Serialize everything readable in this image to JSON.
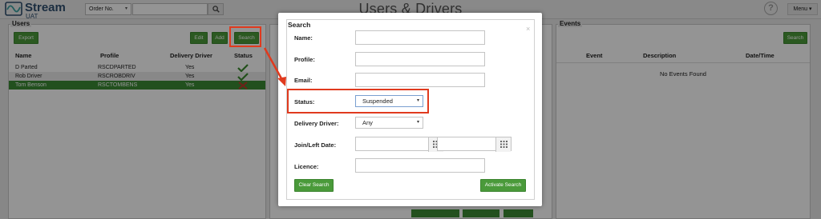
{
  "app": {
    "name": "Stream",
    "environment": "UAT",
    "title": "Users & Drivers",
    "help_symbol": "?",
    "menu_label": "Menu ▾"
  },
  "header": {
    "order_select_value": "Order No.",
    "order_select_caret": "▾"
  },
  "users": {
    "title": "Users",
    "export_label": "Export",
    "edit_label": "Edit",
    "add_label": "Add",
    "search_label": "Search",
    "columns": [
      "Name",
      "Profile",
      "Delivery Driver",
      "Status"
    ],
    "rows": [
      {
        "name": "D Parted",
        "profile": "RSCDPARTED",
        "driver": "Yes"
      },
      {
        "name": "Rob Driver",
        "profile": "RSCROBDRIV",
        "driver": "Yes"
      },
      {
        "name": "Tom Benson",
        "profile": "RSCTOMBENS",
        "driver": "Yes"
      }
    ]
  },
  "events": {
    "title": "Events",
    "search_label": "Search",
    "columns": [
      "Event",
      "Description",
      "Date/Time"
    ],
    "empty_text": "No Events Found"
  },
  "search_modal": {
    "title": "Search",
    "close_symbol": "×",
    "name_label": "Name:",
    "profile_label": "Profile:",
    "email_label": "Email:",
    "status_label": "Status:",
    "status_value": "Suspended",
    "driver_label": "Delivery Driver:",
    "driver_value": "Any",
    "date_label": "Join/Left Date:",
    "licence_label": "Licence:",
    "clear_label": "Clear Search",
    "activate_label": "Activate Search",
    "caret": "▾"
  },
  "colors": {
    "accent_green": "#4a9a3a",
    "selected_row": "#3b8a35",
    "highlight_red": "#e03a1e",
    "brand_blue": "#2f4f6f"
  }
}
